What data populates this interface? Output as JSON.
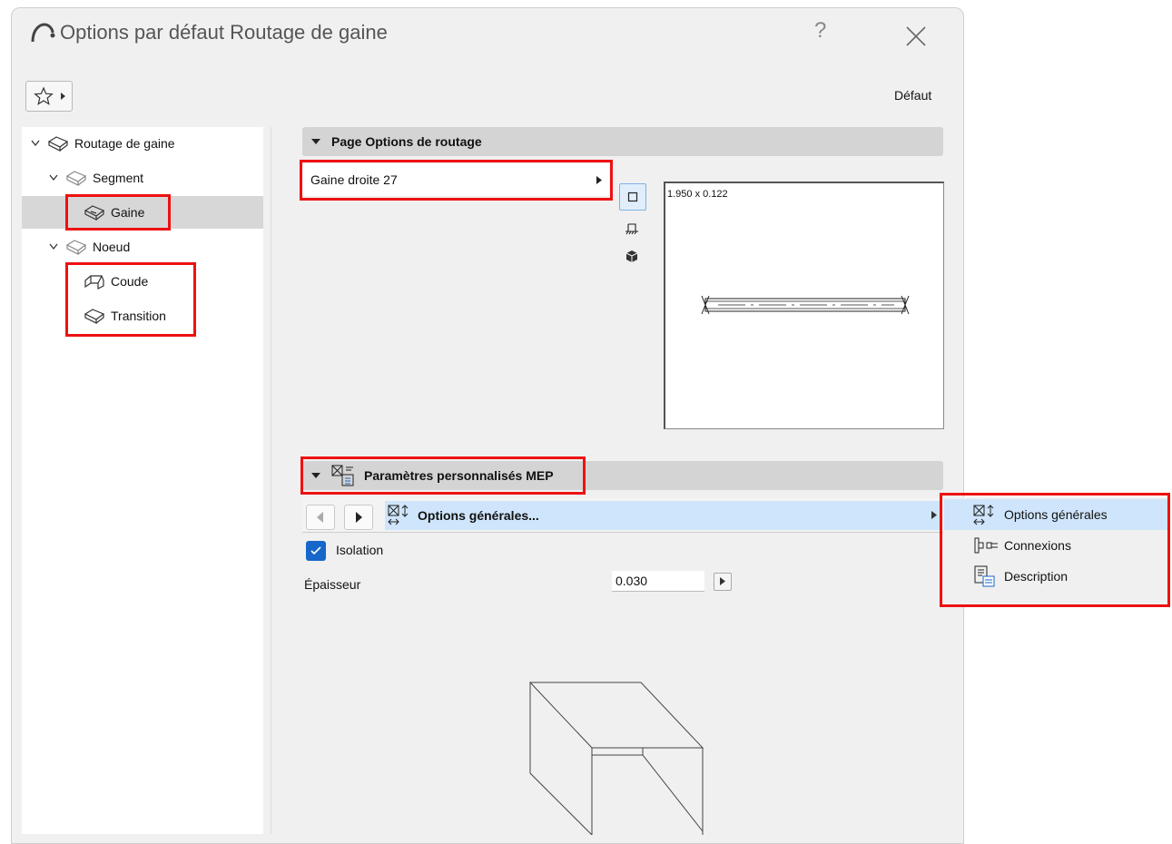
{
  "window": {
    "title": "Options par défaut Routage de gaine",
    "help_label": "?",
    "defaut_label": "Défaut"
  },
  "tree": {
    "items": [
      {
        "label": "Routage de gaine",
        "level": 0,
        "expanded": true,
        "selected": false
      },
      {
        "label": "Segment",
        "level": 1,
        "expanded": true,
        "selected": false
      },
      {
        "label": "Gaine",
        "level": 2,
        "expanded": false,
        "selected": true
      },
      {
        "label": "Noeud",
        "level": 1,
        "expanded": true,
        "selected": false
      },
      {
        "label": "Coude",
        "level": 2,
        "expanded": false,
        "selected": false
      },
      {
        "label": "Transition",
        "level": 2,
        "expanded": false,
        "selected": false
      }
    ]
  },
  "routing_panel": {
    "header": "Page Options de routage",
    "type_value": "Gaine droite 27",
    "preview_dims": "1.950 x 0.122",
    "view_modes": [
      "plan-view-icon",
      "section-view-icon",
      "3d-view-icon"
    ],
    "active_view": "plan-view-icon"
  },
  "mep_panel": {
    "header": "Paramètres personnalisés MEP",
    "page_label": "Options générales...",
    "isolation_label": "Isolation",
    "isolation_checked": true,
    "epaisseur_label": "Épaisseur",
    "epaisseur_value": "0.030"
  },
  "popup_menu": {
    "items": [
      {
        "label": "Options générales",
        "icon": "general-options-icon",
        "selected": true
      },
      {
        "label": "Connexions",
        "icon": "connections-icon",
        "selected": false
      },
      {
        "label": "Description",
        "icon": "description-icon",
        "selected": false
      }
    ]
  },
  "colors": {
    "highlight_box": "#e11111",
    "selection_blue": "#cfe5fb",
    "checkbox_blue": "#1766c9",
    "header_gray": "#d4d4d4"
  }
}
